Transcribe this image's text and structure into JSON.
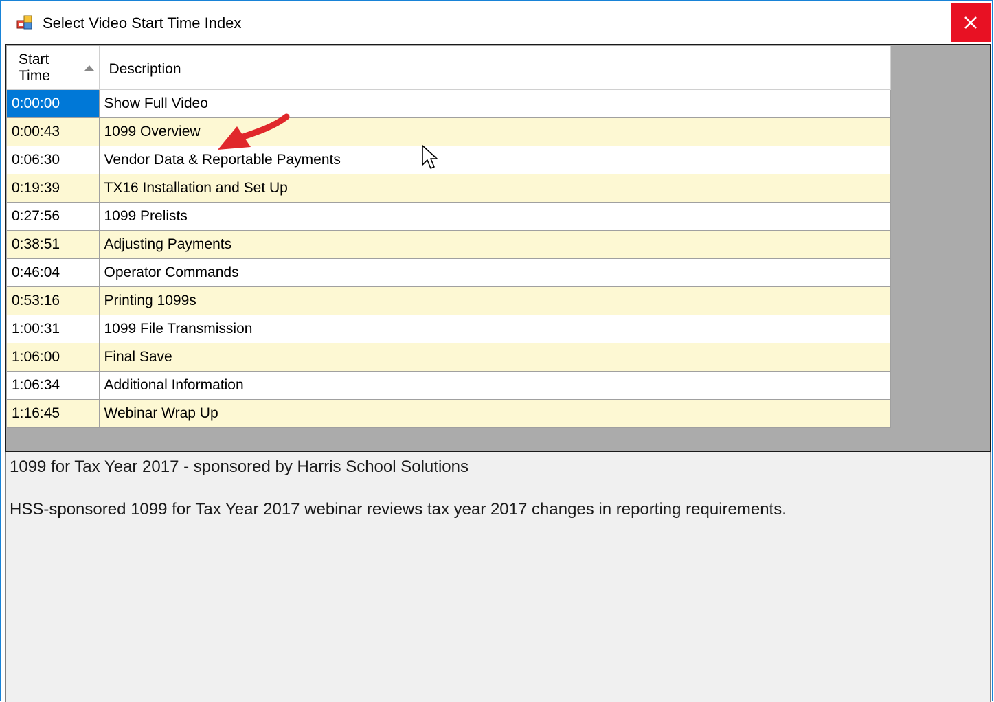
{
  "window": {
    "title": "Select Video Start Time Index",
    "close_icon": "close-icon",
    "app_icon": "app-window-icon"
  },
  "grid": {
    "columns": [
      {
        "label": "Start Time",
        "sort": "ascending"
      },
      {
        "label": "Description"
      }
    ],
    "selected_index": 0,
    "rows": [
      {
        "time": "0:00:00",
        "description": "Show Full Video"
      },
      {
        "time": "0:00:43",
        "description": "1099 Overview"
      },
      {
        "time": "0:06:30",
        "description": "Vendor Data & Reportable Payments"
      },
      {
        "time": "0:19:39",
        "description": "TX16 Installation and Set Up"
      },
      {
        "time": "0:27:56",
        "description": "1099 Prelists"
      },
      {
        "time": "0:38:51",
        "description": "Adjusting Payments"
      },
      {
        "time": "0:46:04",
        "description": "Operator Commands"
      },
      {
        "time": "0:53:16",
        "description": "Printing 1099s"
      },
      {
        "time": "1:00:31",
        "description": "1099 File Transmission"
      },
      {
        "time": "1:06:00",
        "description": "Final Save"
      },
      {
        "time": "1:06:34",
        "description": "Additional Information"
      },
      {
        "time": "1:16:45",
        "description": "Webinar Wrap Up"
      }
    ]
  },
  "info": {
    "title": "1099 for Tax Year 2017 - sponsored by Harris School Solutions",
    "description": "HSS-sponsored 1099 for Tax Year 2017 webinar reviews tax year 2017 changes in reporting requirements."
  },
  "colors": {
    "accent": "#0078d7",
    "close": "#e81123",
    "alt_row": "#fdf8d3",
    "annotation_arrow": "#e0282b"
  }
}
